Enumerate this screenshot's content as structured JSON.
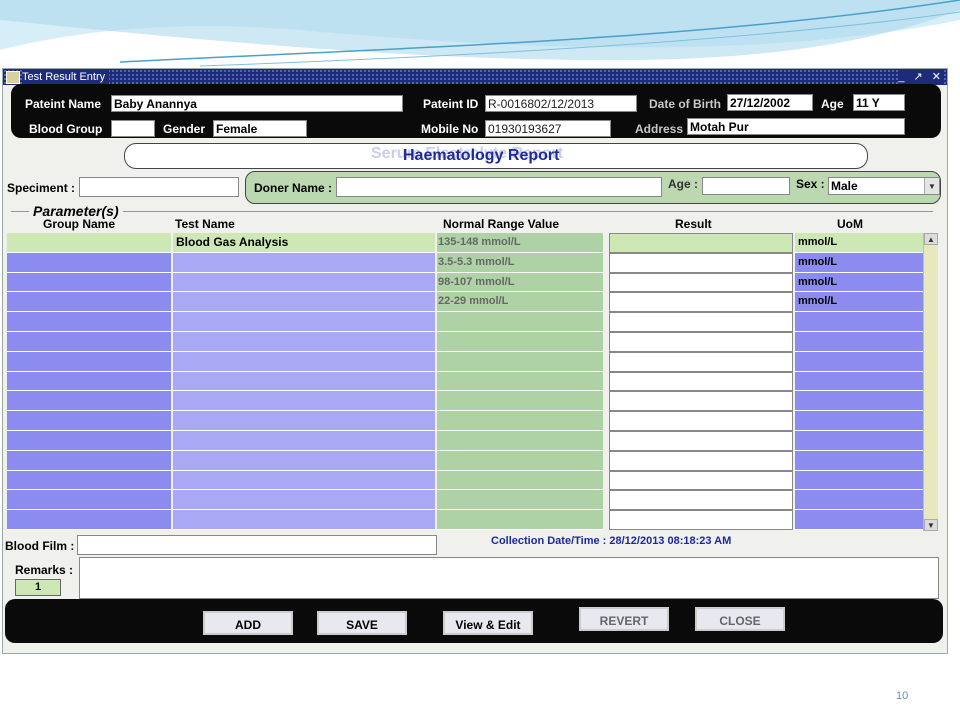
{
  "window": {
    "title": "Test Result Entry",
    "controls": "_ ↗ ✕"
  },
  "patient": {
    "name_label": "Pateint Name",
    "name_value": "Baby Anannya",
    "id_label": "Pateint ID",
    "id_value": "R-0016802/12/2013",
    "dob_label": "Date of Birth",
    "dob_value": "27/12/2002",
    "age_label": "Age",
    "age_value": "11 Y",
    "blood_group_label": "Blood Group",
    "blood_group_value": "",
    "gender_label": "Gender",
    "gender_value": "Female",
    "mobile_label": "Mobile No",
    "mobile_value": "01930193627",
    "address_label": "Address",
    "address_value": "Motah Pur"
  },
  "report": {
    "title": "Haematology Report",
    "ghost_title": "Serum Electrolyte Report"
  },
  "specimen": {
    "label": "Speciment :",
    "value": ""
  },
  "doner": {
    "name_label": "Doner Name :",
    "name_value": "",
    "age_label": "Age :",
    "age_value": "",
    "sex_label": "Sex :",
    "sex_value": "Male"
  },
  "parameters": {
    "section_title": "Parameter(s)",
    "columns": {
      "group": "Group Name",
      "test": "Test Name",
      "normal": "Normal Range Value",
      "result": "Result",
      "uom": "UoM"
    },
    "rows": [
      {
        "group": "",
        "test": "Blood Gas Analysis",
        "normal": "135-148 mmol/L",
        "result": "",
        "uom": "mmol/L"
      },
      {
        "group": "",
        "test": "",
        "normal": "3.5-5.3 mmol/L",
        "result": "",
        "uom": "mmol/L"
      },
      {
        "group": "",
        "test": "",
        "normal": "98-107 mmol/L",
        "result": "",
        "uom": "mmol/L"
      },
      {
        "group": "",
        "test": "",
        "normal": "22-29 mmol/L",
        "result": "",
        "uom": "mmol/L"
      },
      {
        "group": "",
        "test": "",
        "normal": "",
        "result": "",
        "uom": ""
      },
      {
        "group": "",
        "test": "",
        "normal": "",
        "result": "",
        "uom": ""
      },
      {
        "group": "",
        "test": "",
        "normal": "",
        "result": "",
        "uom": ""
      },
      {
        "group": "",
        "test": "",
        "normal": "",
        "result": "",
        "uom": ""
      },
      {
        "group": "",
        "test": "",
        "normal": "",
        "result": "",
        "uom": ""
      },
      {
        "group": "",
        "test": "",
        "normal": "",
        "result": "",
        "uom": ""
      },
      {
        "group": "",
        "test": "",
        "normal": "",
        "result": "",
        "uom": ""
      },
      {
        "group": "",
        "test": "",
        "normal": "",
        "result": "",
        "uom": ""
      },
      {
        "group": "",
        "test": "",
        "normal": "",
        "result": "",
        "uom": ""
      },
      {
        "group": "",
        "test": "",
        "normal": "",
        "result": "",
        "uom": ""
      },
      {
        "group": "",
        "test": "",
        "normal": "",
        "result": "",
        "uom": ""
      }
    ]
  },
  "blood_film": {
    "label": "Blood Film :",
    "value": ""
  },
  "collection": {
    "text": "Collection Date/Time : 28/12/2013 08:18:23 AM"
  },
  "remarks": {
    "label": "Remarks :",
    "value": "",
    "counter": "1"
  },
  "buttons": {
    "add": "ADD",
    "save": "SAVE",
    "view_edit": "View & Edit",
    "revert": "REVERT",
    "close": "CLOSE"
  },
  "slide": {
    "page_number": "10"
  },
  "colors": {
    "header_bg": "#0a0a0a",
    "title_bar": "#1e2a7a",
    "group_col": "#8c8cf0",
    "normal_col": "#aed2a6",
    "highlight_row": "#cde8b4",
    "report_title": "#1e2a9a"
  }
}
